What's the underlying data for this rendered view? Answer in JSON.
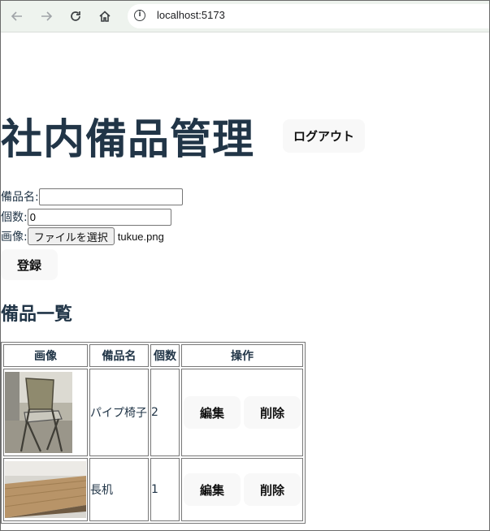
{
  "browser": {
    "url": "localhost:5173"
  },
  "header": {
    "title": "社内備品管理",
    "logout_label": "ログアウト"
  },
  "form": {
    "name_label": "備品名:",
    "name_value": "",
    "count_label": "個数:",
    "count_value": "0",
    "image_label": "画像:",
    "file_button_label": "ファイルを選択",
    "file_name": "tukue.png",
    "register_label": "登録"
  },
  "list": {
    "title": "備品一覧",
    "headers": [
      "画像",
      "備品名",
      "個数",
      "操作"
    ],
    "rows": [
      {
        "name": "パイプ椅子",
        "count": "2",
        "edit_label": "編集",
        "delete_label": "削除"
      },
      {
        "name": "長机",
        "count": "1",
        "edit_label": "編集",
        "delete_label": "削除"
      }
    ]
  },
  "colors": {
    "heading": "#213547",
    "button_bg": "#f8f8f8",
    "chrome_bg": "#eef3ee"
  }
}
